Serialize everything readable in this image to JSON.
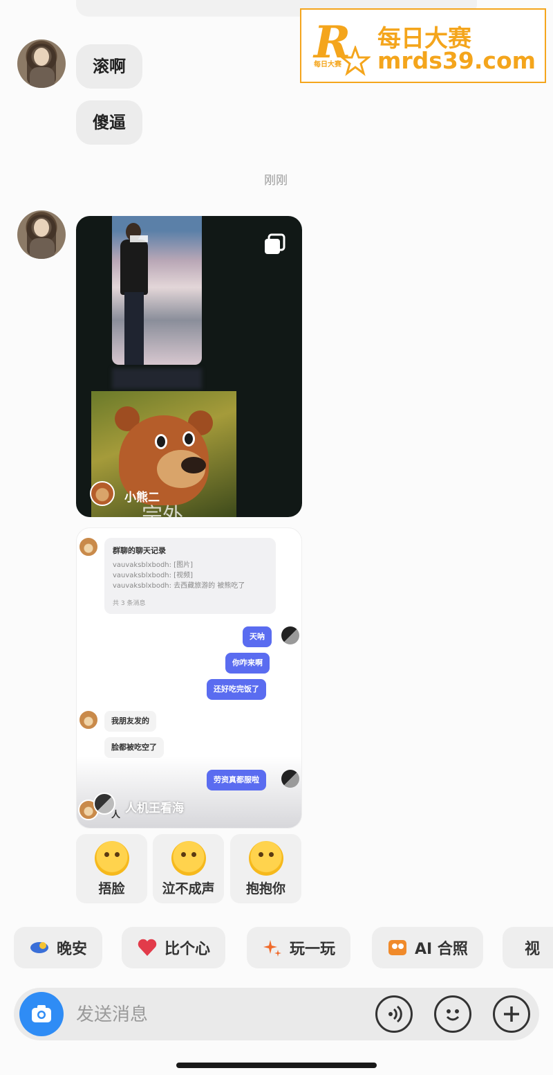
{
  "messages": [
    {
      "text": "滚啊"
    },
    {
      "text": "傻逼"
    }
  ],
  "timestamp": "刚刚",
  "video_card": {
    "author": "小熊二",
    "caption": "宗外"
  },
  "chat_record": {
    "title": "群聊的聊天记录",
    "lines": [
      "vauvaksblxbodh: [图片]",
      "vauvaksblxbodh: [视频]",
      "vauvaksblxbodh: 去西藏旅游的 被熊吃了"
    ],
    "count": "共 3 条消息",
    "bubbles_right_1": [
      "天呐",
      "你咋来啊",
      "还好吃完饭了"
    ],
    "bubbles_left": [
      "我朋友发的",
      "脸都被吃空了"
    ],
    "bubbles_right_2": [
      "劳资真都服啦"
    ],
    "author": "人机王看海",
    "author_suffix": "人"
  },
  "reactions": [
    {
      "label": "捂脸",
      "icon": "facepalm-emoji-icon"
    },
    {
      "label": "泣不成声",
      "icon": "crying-emoji-icon"
    },
    {
      "label": "抱抱你",
      "icon": "hug-emoji-icon"
    }
  ],
  "chips": [
    {
      "label": "晚安",
      "icon": "moon-icon"
    },
    {
      "label": "比个心",
      "icon": "heart-icon"
    },
    {
      "label": "玩一玩",
      "icon": "sparkle-icon"
    },
    {
      "label": "AI 合照",
      "icon": "ai-photo-icon"
    },
    {
      "label": "视",
      "icon": "video-call-icon"
    }
  ],
  "input": {
    "placeholder": "发送消息"
  },
  "watermark": {
    "title": "每日大赛",
    "url": "mrds39.com",
    "tag": "每日大赛",
    "logo_letter": "R"
  },
  "colors": {
    "accent": "#5a6cf0",
    "camera": "#2f8cf5",
    "watermark": "#f4a51c"
  }
}
